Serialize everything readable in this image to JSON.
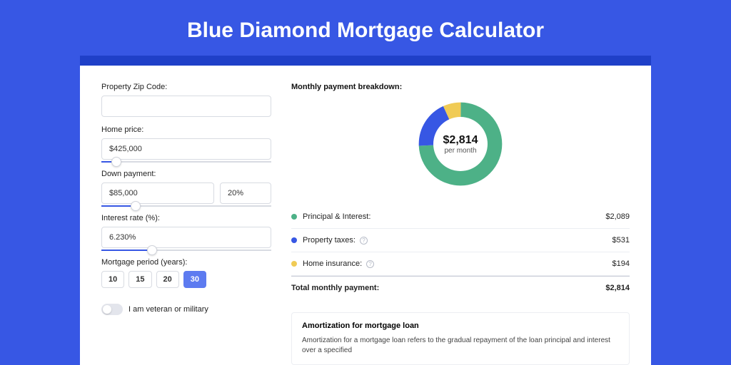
{
  "title": "Blue Diamond Mortgage Calculator",
  "form": {
    "zip_label": "Property Zip Code:",
    "zip_value": "",
    "home_price_label": "Home price:",
    "home_price_value": "$425,000",
    "home_price_slider_pct": 9,
    "down_payment_label": "Down payment:",
    "down_payment_value": "$85,000",
    "down_payment_pct_value": "20%",
    "down_payment_slider_pct": 20,
    "interest_label": "Interest rate (%):",
    "interest_value": "6.230%",
    "interest_slider_pct": 30,
    "period_label": "Mortgage period (years):",
    "period_options": [
      "10",
      "15",
      "20",
      "30"
    ],
    "period_selected": "30",
    "veteran_label": "I am veteran or military"
  },
  "breakdown": {
    "heading": "Monthly payment breakdown:",
    "center_amount": "$2,814",
    "center_sub": "per month",
    "items": [
      {
        "label": "Principal & Interest:",
        "value": "$2,089",
        "color": "#4db187",
        "has_help": false
      },
      {
        "label": "Property taxes:",
        "value": "$531",
        "color": "#3757e4",
        "has_help": true
      },
      {
        "label": "Home insurance:",
        "value": "$194",
        "color": "#f0cb55",
        "has_help": true
      }
    ],
    "total_label": "Total monthly payment:",
    "total_value": "$2,814"
  },
  "amortization": {
    "title": "Amortization for mortgage loan",
    "text": "Amortization for a mortgage loan refers to the gradual repayment of the loan principal and interest over a specified"
  },
  "chart_data": {
    "type": "pie",
    "title": "Monthly payment breakdown",
    "series": [
      {
        "name": "Principal & Interest",
        "value": 2089,
        "color": "#4db187"
      },
      {
        "name": "Property taxes",
        "value": 531,
        "color": "#3757e4"
      },
      {
        "name": "Home insurance",
        "value": 194,
        "color": "#f0cb55"
      }
    ],
    "total": 2814,
    "unit": "$ per month"
  }
}
